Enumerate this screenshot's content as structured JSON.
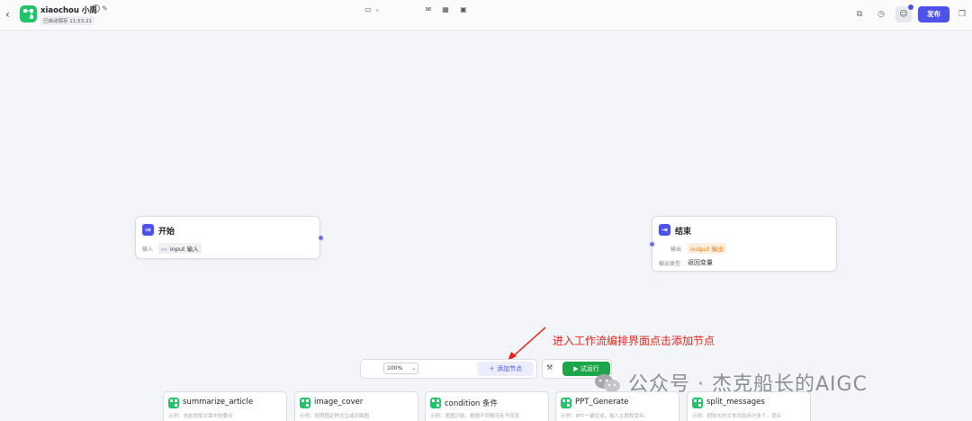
{
  "header": {
    "back_icon": "chevron-left-icon",
    "app_icon": "workflow-icon",
    "title": "xiaochou 小周",
    "save_status": "已自动保存 11:53:21",
    "publish_label": "发布",
    "icons": [
      "copy-icon",
      "history-icon",
      "collaborator-icon",
      "duplicate-icon"
    ]
  },
  "nodes": {
    "start": {
      "title": "开始",
      "input_label": "输入",
      "input_type": "str.",
      "input_name": "input",
      "input_desc": "输入"
    },
    "end": {
      "title": "结束",
      "output_label": "输出",
      "output_name": "output",
      "output_desc": "输出",
      "output_type_label": "输出类型",
      "output_type_value": "返回变量"
    }
  },
  "annotation": "进入工作流编排界面点击添加节点",
  "toolbar": {
    "zoom": "100%",
    "add_node_label": "＋ 添加节点",
    "run_label": "▶ 试运行"
  },
  "watermark": "公众号 · 杰克船长的AIGC",
  "cards": [
    {
      "title": "summarize_article",
      "desc": "示例：总结提炼文章中的要点"
    },
    {
      "title": "image_cover",
      "desc": "示例：按照固定样式生成封面图"
    },
    {
      "title": "condition 条件",
      "desc": "示例：意图识别，根据不同情况走不同流"
    },
    {
      "title": "PPT_Generate",
      "desc": "示例：PPT一键生成，输入主题和受众，"
    },
    {
      "title": "split_messages",
      "desc": "示例：把较长的文本消息拆分多个，适合"
    }
  ],
  "colors": {
    "accent": "#4d53e8",
    "run_green": "#1da54a",
    "app_green": "#22c36b",
    "annotation_red": "#e8231b"
  }
}
